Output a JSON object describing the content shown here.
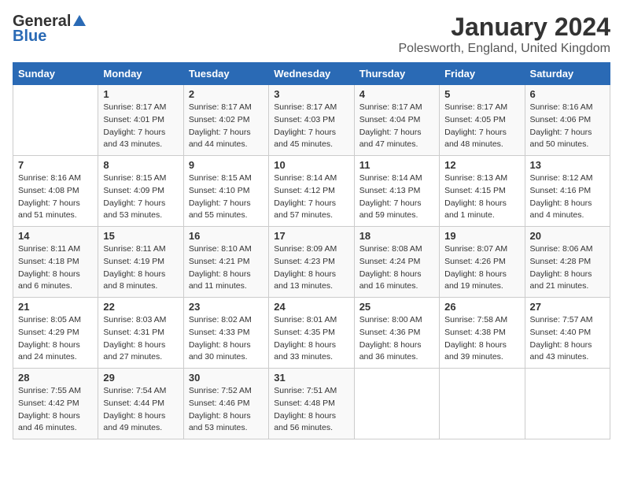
{
  "header": {
    "logo_general": "General",
    "logo_blue": "Blue",
    "month_title": "January 2024",
    "location": "Polesworth, England, United Kingdom"
  },
  "days_of_week": [
    "Sunday",
    "Monday",
    "Tuesday",
    "Wednesday",
    "Thursday",
    "Friday",
    "Saturday"
  ],
  "weeks": [
    [
      {
        "day": "",
        "sunrise": "",
        "sunset": "",
        "daylight": ""
      },
      {
        "day": "1",
        "sunrise": "Sunrise: 8:17 AM",
        "sunset": "Sunset: 4:01 PM",
        "daylight": "Daylight: 7 hours and 43 minutes."
      },
      {
        "day": "2",
        "sunrise": "Sunrise: 8:17 AM",
        "sunset": "Sunset: 4:02 PM",
        "daylight": "Daylight: 7 hours and 44 minutes."
      },
      {
        "day": "3",
        "sunrise": "Sunrise: 8:17 AM",
        "sunset": "Sunset: 4:03 PM",
        "daylight": "Daylight: 7 hours and 45 minutes."
      },
      {
        "day": "4",
        "sunrise": "Sunrise: 8:17 AM",
        "sunset": "Sunset: 4:04 PM",
        "daylight": "Daylight: 7 hours and 47 minutes."
      },
      {
        "day": "5",
        "sunrise": "Sunrise: 8:17 AM",
        "sunset": "Sunset: 4:05 PM",
        "daylight": "Daylight: 7 hours and 48 minutes."
      },
      {
        "day": "6",
        "sunrise": "Sunrise: 8:16 AM",
        "sunset": "Sunset: 4:06 PM",
        "daylight": "Daylight: 7 hours and 50 minutes."
      }
    ],
    [
      {
        "day": "7",
        "sunrise": "Sunrise: 8:16 AM",
        "sunset": "Sunset: 4:08 PM",
        "daylight": "Daylight: 7 hours and 51 minutes."
      },
      {
        "day": "8",
        "sunrise": "Sunrise: 8:15 AM",
        "sunset": "Sunset: 4:09 PM",
        "daylight": "Daylight: 7 hours and 53 minutes."
      },
      {
        "day": "9",
        "sunrise": "Sunrise: 8:15 AM",
        "sunset": "Sunset: 4:10 PM",
        "daylight": "Daylight: 7 hours and 55 minutes."
      },
      {
        "day": "10",
        "sunrise": "Sunrise: 8:14 AM",
        "sunset": "Sunset: 4:12 PM",
        "daylight": "Daylight: 7 hours and 57 minutes."
      },
      {
        "day": "11",
        "sunrise": "Sunrise: 8:14 AM",
        "sunset": "Sunset: 4:13 PM",
        "daylight": "Daylight: 7 hours and 59 minutes."
      },
      {
        "day": "12",
        "sunrise": "Sunrise: 8:13 AM",
        "sunset": "Sunset: 4:15 PM",
        "daylight": "Daylight: 8 hours and 1 minute."
      },
      {
        "day": "13",
        "sunrise": "Sunrise: 8:12 AM",
        "sunset": "Sunset: 4:16 PM",
        "daylight": "Daylight: 8 hours and 4 minutes."
      }
    ],
    [
      {
        "day": "14",
        "sunrise": "Sunrise: 8:11 AM",
        "sunset": "Sunset: 4:18 PM",
        "daylight": "Daylight: 8 hours and 6 minutes."
      },
      {
        "day": "15",
        "sunrise": "Sunrise: 8:11 AM",
        "sunset": "Sunset: 4:19 PM",
        "daylight": "Daylight: 8 hours and 8 minutes."
      },
      {
        "day": "16",
        "sunrise": "Sunrise: 8:10 AM",
        "sunset": "Sunset: 4:21 PM",
        "daylight": "Daylight: 8 hours and 11 minutes."
      },
      {
        "day": "17",
        "sunrise": "Sunrise: 8:09 AM",
        "sunset": "Sunset: 4:23 PM",
        "daylight": "Daylight: 8 hours and 13 minutes."
      },
      {
        "day": "18",
        "sunrise": "Sunrise: 8:08 AM",
        "sunset": "Sunset: 4:24 PM",
        "daylight": "Daylight: 8 hours and 16 minutes."
      },
      {
        "day": "19",
        "sunrise": "Sunrise: 8:07 AM",
        "sunset": "Sunset: 4:26 PM",
        "daylight": "Daylight: 8 hours and 19 minutes."
      },
      {
        "day": "20",
        "sunrise": "Sunrise: 8:06 AM",
        "sunset": "Sunset: 4:28 PM",
        "daylight": "Daylight: 8 hours and 21 minutes."
      }
    ],
    [
      {
        "day": "21",
        "sunrise": "Sunrise: 8:05 AM",
        "sunset": "Sunset: 4:29 PM",
        "daylight": "Daylight: 8 hours and 24 minutes."
      },
      {
        "day": "22",
        "sunrise": "Sunrise: 8:03 AM",
        "sunset": "Sunset: 4:31 PM",
        "daylight": "Daylight: 8 hours and 27 minutes."
      },
      {
        "day": "23",
        "sunrise": "Sunrise: 8:02 AM",
        "sunset": "Sunset: 4:33 PM",
        "daylight": "Daylight: 8 hours and 30 minutes."
      },
      {
        "day": "24",
        "sunrise": "Sunrise: 8:01 AM",
        "sunset": "Sunset: 4:35 PM",
        "daylight": "Daylight: 8 hours and 33 minutes."
      },
      {
        "day": "25",
        "sunrise": "Sunrise: 8:00 AM",
        "sunset": "Sunset: 4:36 PM",
        "daylight": "Daylight: 8 hours and 36 minutes."
      },
      {
        "day": "26",
        "sunrise": "Sunrise: 7:58 AM",
        "sunset": "Sunset: 4:38 PM",
        "daylight": "Daylight: 8 hours and 39 minutes."
      },
      {
        "day": "27",
        "sunrise": "Sunrise: 7:57 AM",
        "sunset": "Sunset: 4:40 PM",
        "daylight": "Daylight: 8 hours and 43 minutes."
      }
    ],
    [
      {
        "day": "28",
        "sunrise": "Sunrise: 7:55 AM",
        "sunset": "Sunset: 4:42 PM",
        "daylight": "Daylight: 8 hours and 46 minutes."
      },
      {
        "day": "29",
        "sunrise": "Sunrise: 7:54 AM",
        "sunset": "Sunset: 4:44 PM",
        "daylight": "Daylight: 8 hours and 49 minutes."
      },
      {
        "day": "30",
        "sunrise": "Sunrise: 7:52 AM",
        "sunset": "Sunset: 4:46 PM",
        "daylight": "Daylight: 8 hours and 53 minutes."
      },
      {
        "day": "31",
        "sunrise": "Sunrise: 7:51 AM",
        "sunset": "Sunset: 4:48 PM",
        "daylight": "Daylight: 8 hours and 56 minutes."
      },
      {
        "day": "",
        "sunrise": "",
        "sunset": "",
        "daylight": ""
      },
      {
        "day": "",
        "sunrise": "",
        "sunset": "",
        "daylight": ""
      },
      {
        "day": "",
        "sunrise": "",
        "sunset": "",
        "daylight": ""
      }
    ]
  ]
}
